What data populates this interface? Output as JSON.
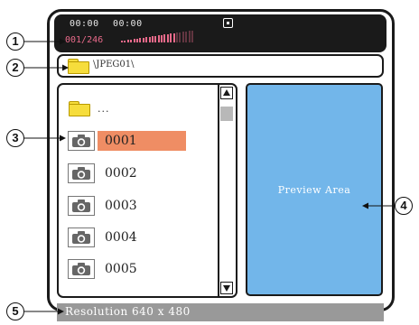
{
  "status_bar": {
    "time_elapsed": "00:00",
    "time_total": "00:00",
    "track_counter": "001/246",
    "volume_level": 0.75
  },
  "path_bar": {
    "path": "\\JPEG01\\"
  },
  "file_list": {
    "parent_label": "...",
    "files": [
      "0001",
      "0002",
      "0003",
      "0004",
      "0005"
    ],
    "selected_index": 0
  },
  "preview": {
    "label": "Preview Area"
  },
  "info_bar": {
    "text": "Resolution  640 x 480"
  },
  "callouts": [
    "1",
    "2",
    "3",
    "4",
    "5"
  ],
  "colors": {
    "status_bar_bg": "#1a1a1a",
    "volume_color": "#e86a8a",
    "selection_highlight": "#ef8d64",
    "preview_bg": "#72b6ea",
    "info_bar_bg": "#999999",
    "folder_color": "#f6dd3c"
  },
  "icons": [
    "folder-icon",
    "camera-icon",
    "stop-icon",
    "scroll-up-icon",
    "scroll-down-icon"
  ]
}
